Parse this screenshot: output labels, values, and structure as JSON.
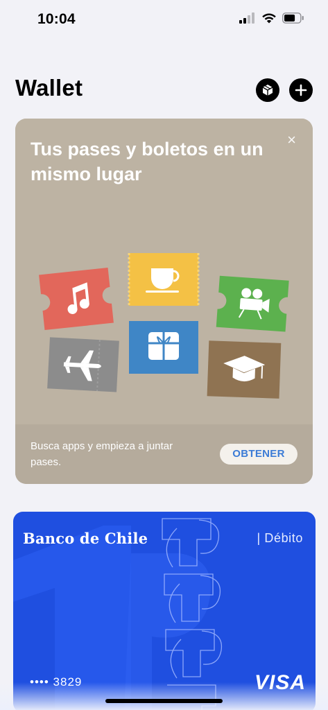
{
  "status_bar": {
    "time": "10:04",
    "icons": [
      "cellular-signal-icon",
      "wifi-icon",
      "battery-icon"
    ],
    "battery_level": 0.7
  },
  "header": {
    "title": "Wallet",
    "icons": [
      "box-icon",
      "plus-icon"
    ]
  },
  "promo": {
    "title": "Tus pases y boletos en un mismo lugar",
    "description": "Busca apps y empieza a juntar pases.",
    "button_label": "OBTENER",
    "close_label": "×",
    "icons": [
      "music-ticket-icon",
      "coffee-ticket-icon",
      "movie-camera-ticket-icon",
      "airplane-ticket-icon",
      "gift-ticket-icon",
      "graduation-cap-ticket-icon"
    ],
    "colors": {
      "background": "#bdb3a3",
      "music": "#e2675b",
      "coffee": "#f4c145",
      "movie": "#5cb14e",
      "airplane": "#8c8c8c",
      "gift": "#3f86c6",
      "graduation": "#8f7352"
    }
  },
  "card": {
    "bank_name": "Banco de Chile",
    "type": "| Débito",
    "number": "•••• 3829",
    "network": "VISA",
    "color": "#1f4fe0"
  }
}
